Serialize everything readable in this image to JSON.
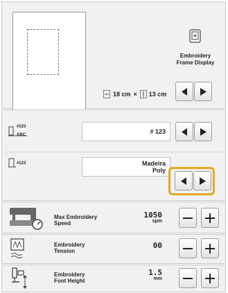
{
  "frame_display": {
    "label": "Embroidery\nFrame Display",
    "icon": "embroidery-frame-icon"
  },
  "size": {
    "width": "18 cm",
    "times": "×",
    "height": "13 cm"
  },
  "thread_number_display": {
    "icon_top": "#123",
    "icon_bottom": "ABC",
    "value": "# 123"
  },
  "thread_brand": {
    "icon_label": "#123",
    "value_line1": "Madeira",
    "value_line2": "Poly"
  },
  "max_speed": {
    "label": "Max Embroidery\nSpeed",
    "value": "1050",
    "unit": "spm"
  },
  "tension": {
    "label": "Embroidery\nTension",
    "value": "00"
  },
  "foot_height": {
    "label": "Embroidery\nFoot Height",
    "value": "1.5",
    "unit": "mm"
  },
  "colors": {
    "highlight": "#e3a923",
    "panel": "#f1f1f1"
  }
}
